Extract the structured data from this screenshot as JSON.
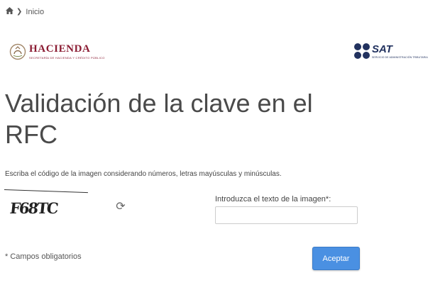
{
  "breadcrumb": {
    "current": "Inicio"
  },
  "header": {
    "left_logo_text": "HACIENDA",
    "left_logo_subtext": "SECRETARÍA DE HACIENDA Y CRÉDITO PÚBLICO",
    "right_logo_text": "SAT",
    "right_logo_subtext": "SERVICIO DE ADMINISTRACIÓN TRIBUTARIA"
  },
  "page": {
    "title": "Validación de la clave en el RFC",
    "instructions": "Escriba el código de la imagen considerando números, letras mayúsculas y minúsculas."
  },
  "captcha": {
    "text": "F68TC"
  },
  "form": {
    "field_label": "Introduzca el texto de la imagen*:",
    "field_value": "",
    "required_note": "* Campos obligatorios",
    "submit_label": "Aceptar"
  },
  "colors": {
    "primary_button": "#4a90e2",
    "hacienda_brand": "#8b1c33",
    "sat_brand": "#22325f"
  }
}
